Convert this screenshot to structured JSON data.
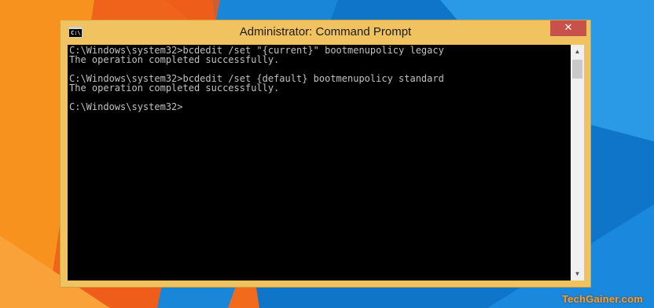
{
  "window": {
    "title": "Administrator: Command Prompt",
    "icon": "cmd-icon",
    "icon_text": "C:\\",
    "minimize_symbol": "—",
    "maximize_symbol": "☐",
    "close_symbol": "✕"
  },
  "console": {
    "lines": [
      "C:\\Windows\\system32>bcdedit /set \"{current}\" bootmenupolicy legacy",
      "The operation completed successfully.",
      "",
      "C:\\Windows\\system32>bcdedit /set {default} bootmenupolicy standard",
      "The operation completed successfully.",
      "",
      "C:\\Windows\\system32>"
    ]
  },
  "scrollbar": {
    "up_symbol": "▲",
    "down_symbol": "▼"
  },
  "watermark": "TechGainer.com",
  "colors": {
    "window_frame": "#f0c260",
    "close_button": "#c7514b",
    "console_bg": "#000000",
    "console_text": "#c0c0c0",
    "desktop_blue": "#0e75c9",
    "desktop_orange": "#f4731f"
  }
}
